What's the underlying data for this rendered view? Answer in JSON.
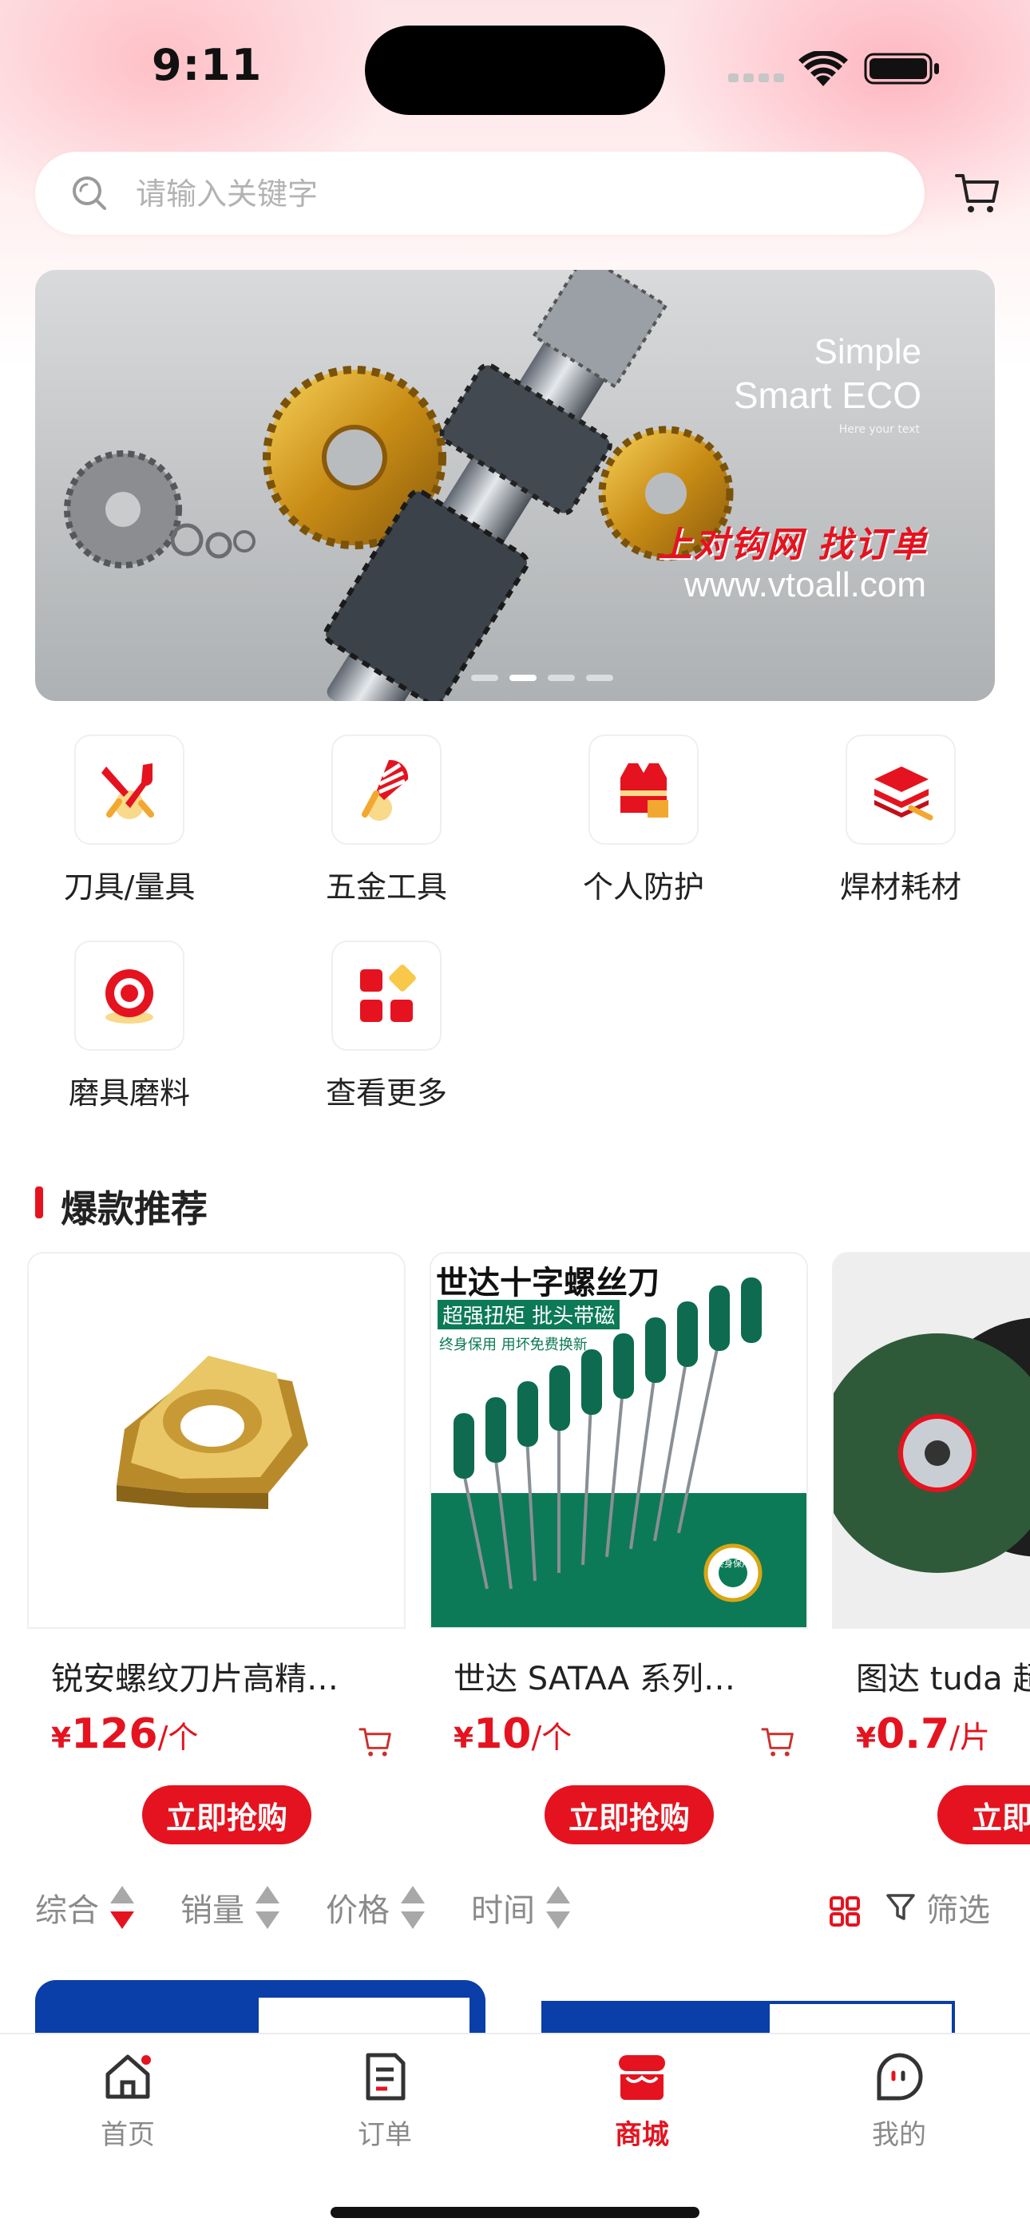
{
  "status": {
    "time": "9:11"
  },
  "search": {
    "placeholder": "请输入关键字"
  },
  "banner": {
    "tagline1": "Simple",
    "tagline2": "Smart ECO",
    "small_text": "Here your text",
    "slogan": "上对钩网  找订单",
    "url": "www.vtoall.com",
    "page_count": 4,
    "active_page": 2
  },
  "categories": [
    {
      "label": "刀具/量具",
      "icon": "tools-icon"
    },
    {
      "label": "五金工具",
      "icon": "screw-icon"
    },
    {
      "label": "个人防护",
      "icon": "safety-vest-icon"
    },
    {
      "label": "焊材耗材",
      "icon": "welding-materials-icon"
    },
    {
      "label": "磨具磨料",
      "icon": "grinding-wheel-icon"
    },
    {
      "label": "查看更多",
      "icon": "more-grid-icon"
    }
  ],
  "hot_section": {
    "title": "爆款推荐"
  },
  "hot_products": [
    {
      "name": "锐安螺纹刀片高精…",
      "currency": "¥",
      "price": "126",
      "unit": "/个",
      "buy_label": "立即抢购"
    },
    {
      "name": "世达 SATAA 系列…",
      "currency": "¥",
      "price": "10",
      "unit": "/个",
      "buy_label": "立即抢购",
      "image_text": {
        "title": "世达十字螺丝刀",
        "subtitle": "超强扭矩 批头带磁",
        "note": "终身保用 用坏免费换新",
        "seal": "终身保用"
      }
    },
    {
      "name": "图达 tuda 超",
      "currency": "¥",
      "price": "0.7",
      "unit": "/片",
      "buy_label": "立即抢"
    }
  ],
  "sort_bar": {
    "items": [
      "综合",
      "销量",
      "价格",
      "时间"
    ],
    "active_index": 0,
    "filter_label": "筛选"
  },
  "tabbar": {
    "items": [
      {
        "label": "首页",
        "icon": "home-icon"
      },
      {
        "label": "订单",
        "icon": "order-icon"
      },
      {
        "label": "商城",
        "icon": "store-icon"
      },
      {
        "label": "我的",
        "icon": "profile-icon"
      }
    ],
    "active_index": 2
  },
  "colors": {
    "accent": "#e5131f",
    "muted_text": "#8a8a8a"
  }
}
